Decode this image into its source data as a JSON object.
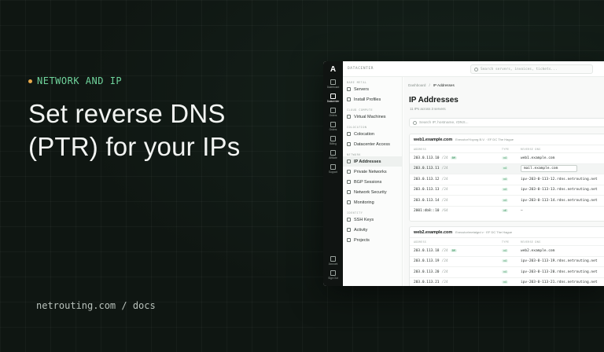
{
  "hero": {
    "eyebrow": "NETWORK AND IP",
    "headline_line1": "Set reverse DNS",
    "headline_line2": "(PTR) for your IPs",
    "footer_url": "netrouting.com / docs"
  },
  "colors": {
    "background": "#0f1612",
    "accent_green": "#6fd39b",
    "accent_orange": "#e8a94b"
  },
  "app": {
    "logo": "A",
    "topbar_section": "DATACENTER",
    "search_placeholder": "Search servers, invoices, tickets...",
    "rail": [
      {
        "label": "Dashboard",
        "icon": "grid-icon"
      },
      {
        "label": "Datacenter",
        "icon": "server-icon",
        "active": true
      },
      {
        "label": "Orders",
        "icon": "cart-icon"
      },
      {
        "label": "Orders",
        "icon": "box-icon"
      },
      {
        "label": "Billing",
        "icon": "invoice-icon"
      },
      {
        "label": "Affiliate",
        "icon": "users-icon"
      },
      {
        "label": "Support",
        "icon": "support-icon"
      }
    ],
    "rail_bottom": [
      {
        "label": "Account",
        "icon": "user-icon"
      },
      {
        "label": "Sign Out",
        "icon": "logout-icon"
      }
    ],
    "sidebar": {
      "group_bare_metal": "BARE METAL",
      "servers": "Servers",
      "install_profiles": "Install Profiles",
      "group_cloud_compute": "CLOUD COMPUTE",
      "virtual_machines": "Virtual Machines",
      "group_colocation": "COLOCATION",
      "colocation": "Colocation",
      "datacenter_access": "Datacenter Access",
      "group_network": "NETWORK",
      "ip_addresses": "IP Addresses",
      "private_networks": "Private Networks",
      "bgp_sessions": "BGP Sessions",
      "network_security": "Network Security",
      "monitoring": "Monitoring",
      "group_identity": "IDENTITY",
      "ssh_keys": "SSH Keys",
      "activity": "Activity",
      "projects": "Projects"
    },
    "breadcrumb": {
      "root": "Dashboard",
      "current": "IP Addresses"
    },
    "page_title": "IP Addresses",
    "page_subtitle": "11 IPs across 3 servers",
    "filter_placeholder": "Search IP, hostname, rDNS...",
    "columns": {
      "address": "ADDRESS",
      "family": "TYPE",
      "ptr": "REVERSE DNS"
    },
    "cards": [
      {
        "server": "web1.example.com",
        "meta": "Executor/Yoyorg B.V.  ·  EF DC The Hague",
        "rows": [
          {
            "address": "203.0.113.10",
            "cidr": "/24",
            "badge": "BM",
            "family": "v4",
            "ptr": "web1.example.com"
          },
          {
            "address": "203.0.113.11",
            "cidr": "/24",
            "badge": "",
            "family": "v4",
            "ptr": "mail.example.com",
            "editing": true
          },
          {
            "address": "203.0.113.12",
            "cidr": "/24",
            "badge": "",
            "family": "v4",
            "ptr": "ipv-203-0-113-12.rdns.netrouting.net"
          },
          {
            "address": "203.0.113.13",
            "cidr": "/24",
            "badge": "",
            "family": "v4",
            "ptr": "ipv-203-0-113-13.rdns.netrouting.net"
          },
          {
            "address": "203.0.113.14",
            "cidr": "/24",
            "badge": "",
            "family": "v4",
            "ptr": "ipv-203-0-113-14.rdns.netrouting.net"
          },
          {
            "address": "2001:db8::10",
            "cidr": "/64",
            "badge": "",
            "family": "v6",
            "ptr": "—"
          }
        ]
      },
      {
        "server": "web2.example.com",
        "meta": "Executor/metalgrd v  ·  EF DC The Hague",
        "rows": [
          {
            "address": "203.0.113.18",
            "cidr": "/24",
            "badge": "BM",
            "family": "v4",
            "ptr": "web2.example.com"
          },
          {
            "address": "203.0.113.19",
            "cidr": "/24",
            "badge": "",
            "family": "v4",
            "ptr": "ipv-203-0-113-19.rdns.netrouting.net"
          },
          {
            "address": "203.0.113.20",
            "cidr": "/24",
            "badge": "",
            "family": "v4",
            "ptr": "ipv-203-0-113-20.rdns.netrouting.net"
          },
          {
            "address": "203.0.113.21",
            "cidr": "/24",
            "badge": "",
            "family": "v4",
            "ptr": "ipv-203-0-113-21.rdns.netrouting.net"
          }
        ]
      }
    ]
  }
}
